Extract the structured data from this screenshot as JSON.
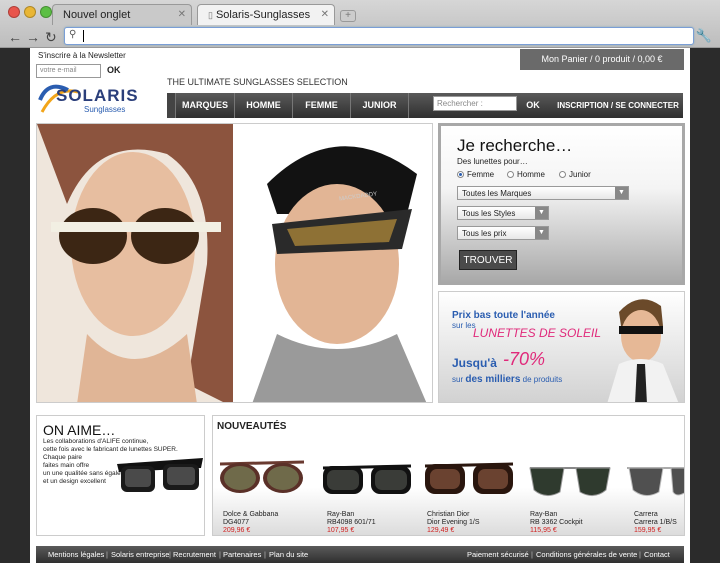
{
  "browser": {
    "tabs": [
      {
        "label": "Nouvel onglet",
        "active": false
      },
      {
        "label": "Solaris-Sunglasses",
        "active": true
      }
    ],
    "url": ""
  },
  "header": {
    "newsletter_label": "S'inscrire à la Newsletter",
    "email_placeholder": "votre e-mail",
    "ok_label": "OK",
    "logo_text": "SOLARIS",
    "logo_sub": "Sunglasses",
    "tagline": "THE ULTIMATE SUNGLASSES SELECTION",
    "cart": "Mon Panier / 0 produit / 0,00 €"
  },
  "nav": {
    "items": [
      "MARQUES",
      "HOMME",
      "FEMME",
      "JUNIOR"
    ],
    "search_placeholder": "Rechercher :",
    "search_ok": "OK",
    "account": "INSCRIPTION / SE CONNECTER"
  },
  "hero": {
    "brand_on_glasses": "MACKDADDY"
  },
  "search_panel": {
    "title": "Je recherche…",
    "subtitle": "Des lunettes pour…",
    "options": [
      "Femme",
      "Homme",
      "Junior"
    ],
    "selected_option": "Femme",
    "brands_select": "Toutes les Marques",
    "styles_select": "Tous les Styles",
    "price_select": "Tous les prix",
    "submit": "TROUVER"
  },
  "promo": {
    "line1": "Prix bas toute l'année",
    "line2": "sur les",
    "highlight": "LUNETTES DE SOLEIL",
    "line3_pre": "Jusqu'à",
    "discount": "-70%",
    "line4_pre": "sur",
    "line4_mid": "des milliers",
    "line4_post": "de produits"
  },
  "on_aime": {
    "title": "ON AIME…",
    "text": [
      "Les collaborations d'ALIFE continue,",
      "cette fois avec le fabricant de lunettes SUPER.",
      "Chaque paire",
      "faites main offre",
      "un une qualitée sans égale",
      "et un design excellent"
    ]
  },
  "nouveautes": {
    "title": "NOUVEAUTÉS",
    "products": [
      {
        "brand": "Dolce & Gabbana",
        "model": "DG4077",
        "price": "209,96 €"
      },
      {
        "brand": "Ray-Ban",
        "model": "RB4098 601/71",
        "price": "107,95 €"
      },
      {
        "brand": "Christian Dior",
        "model": "Dior Evening 1/S",
        "price": "129,49 €"
      },
      {
        "brand": "Ray-Ban",
        "model": "RB 3362 Cockpit",
        "price": "115,95 €"
      },
      {
        "brand": "Carrera",
        "model": "Carrera 1/B/S",
        "price": "159,95 €"
      }
    ]
  },
  "footer": {
    "left": [
      "Mentions légales",
      "Solaris entreprise",
      "Recrutement",
      "Partenaires",
      "Plan du site"
    ],
    "right": [
      "Paiement sécurisé",
      "Conditions générales de vente",
      "Contact"
    ]
  },
  "colors": {
    "accent_blue": "#2a5db0",
    "promo_pink": "#e0297a",
    "price_red": "#d02020"
  }
}
